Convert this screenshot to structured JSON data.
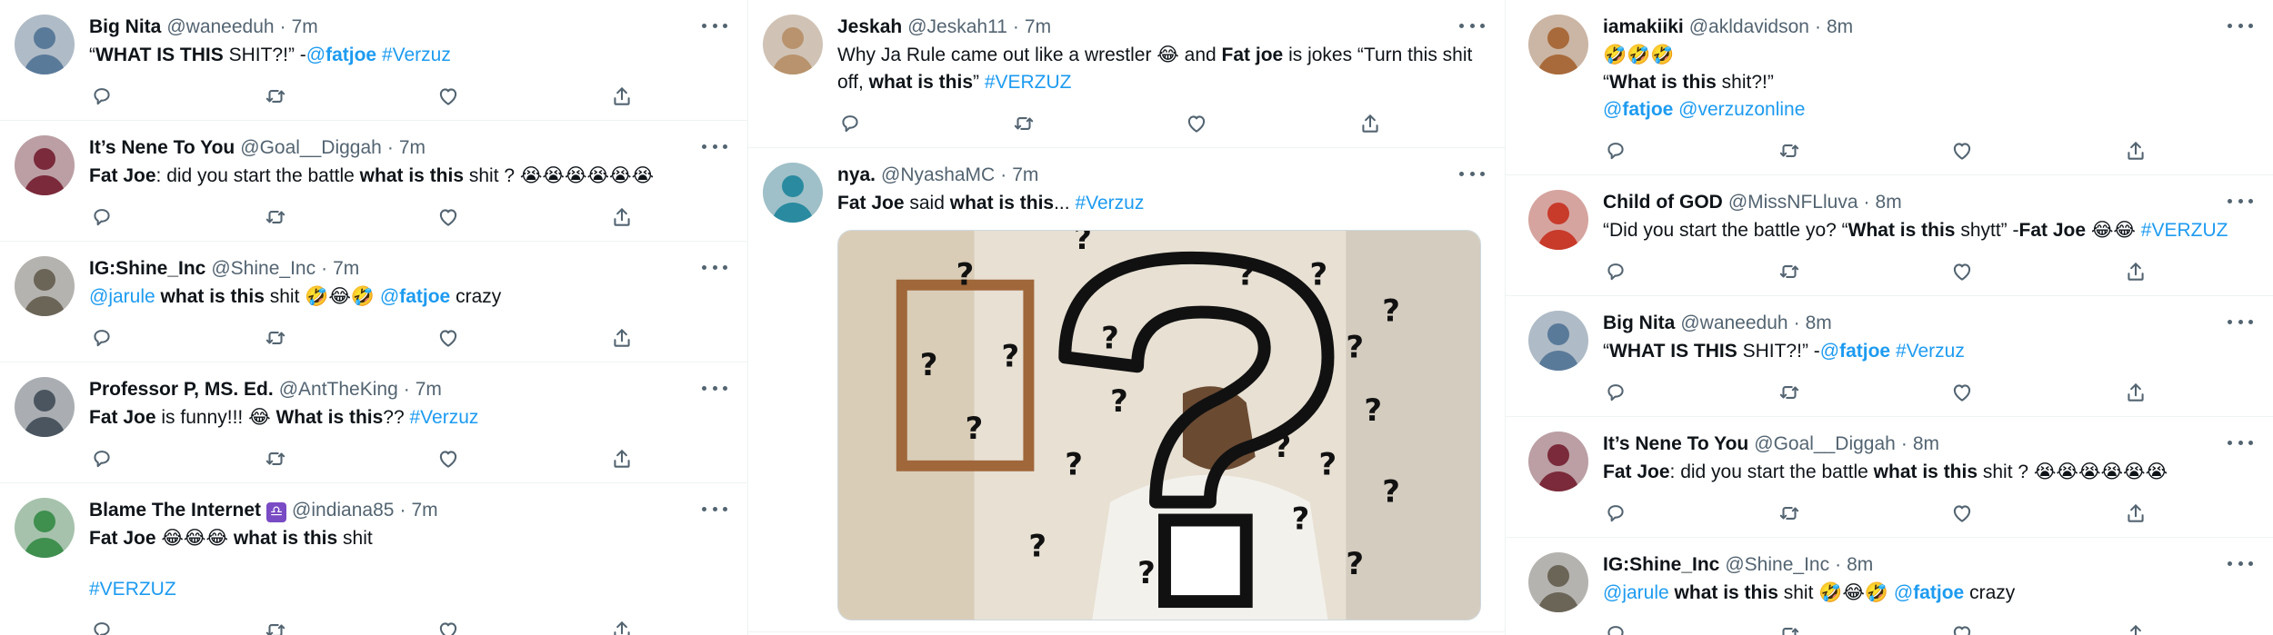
{
  "columns": [
    {
      "tweets": [
        {
          "name": "Big Nita",
          "handle": "@waneeduh",
          "time": "7m",
          "avatar_color": "#5a7a9a",
          "segments": [
            {
              "t": "“",
              "s": "n"
            },
            {
              "t": "WHAT IS THIS",
              "s": "b"
            },
            {
              "t": " SHIT?!” -",
              "s": "n"
            },
            {
              "t": "@",
              "s": "l"
            },
            {
              "t": "fatjoe",
              "s": "lb"
            },
            {
              "t": " #Verzuz",
              "s": "l"
            }
          ]
        },
        {
          "name": "It’s Nene To You",
          "handle": "@Goal__Diggah",
          "time": "7m",
          "avatar_color": "#7a2a3a",
          "segments": [
            {
              "t": "Fat Joe",
              "s": "b"
            },
            {
              "t": ": did you start the battle ",
              "s": "n"
            },
            {
              "t": "what is this",
              "s": "b"
            },
            {
              "t": " shit ? 😭😭😭😭😭😭",
              "s": "n"
            }
          ]
        },
        {
          "name": "IG:Shine_Inc",
          "handle": "@Shine_Inc",
          "time": "7m",
          "avatar_color": "#6b6558",
          "segments": [
            {
              "t": "@jarule",
              "s": "l"
            },
            {
              "t": " ",
              "s": "n"
            },
            {
              "t": "what is this",
              "s": "b"
            },
            {
              "t": " shit 🤣😂🤣 ",
              "s": "n"
            },
            {
              "t": "@",
              "s": "l"
            },
            {
              "t": "fatjoe",
              "s": "lb"
            },
            {
              "t": " crazy",
              "s": "n"
            }
          ]
        },
        {
          "name": "Professor P, MS. Ed.",
          "handle": "@AntTheKing",
          "time": "7m",
          "avatar_color": "#4a5560",
          "segments": [
            {
              "t": "Fat Joe",
              "s": "b"
            },
            {
              "t": " is funny!!! 😂 ",
              "s": "n"
            },
            {
              "t": "What is this",
              "s": "b"
            },
            {
              "t": "?? ",
              "s": "n"
            },
            {
              "t": "#Verzuz",
              "s": "l"
            }
          ]
        },
        {
          "name": "Blame The Internet",
          "badge": "♎",
          "handle": "@indiana85",
          "time": "7m",
          "avatar_color": "#3f8f4f",
          "segments": [
            {
              "t": "Fat Joe",
              "s": "b"
            },
            {
              "t": " 😂😂😂 ",
              "s": "n"
            },
            {
              "t": "what is this",
              "s": "b"
            },
            {
              "t": " shit",
              "s": "n"
            },
            {
              "t": "",
              "s": "br"
            },
            {
              "t": "#VERZUZ",
              "s": "l"
            }
          ]
        }
      ]
    },
    {
      "tweets": [
        {
          "name": "Jeskah",
          "handle": "@Jeskah11",
          "time": "7m",
          "avatar_color": "#b8936d",
          "segments": [
            {
              "t": "Why Ja Rule came out like a wrestler 😂 and ",
              "s": "n"
            },
            {
              "t": "Fat joe",
              "s": "b"
            },
            {
              "t": " is jokes “Turn this shit off, ",
              "s": "n"
            },
            {
              "t": "what is this",
              "s": "b"
            },
            {
              "t": "” ",
              "s": "n"
            },
            {
              "t": "#VERZUZ",
              "s": "l"
            }
          ]
        },
        {
          "name": "nya.",
          "handle": "@NyashaMC",
          "time": "7m",
          "avatar_color": "#2a8aa0",
          "segments": [
            {
              "t": "Fat Joe",
              "s": "b"
            },
            {
              "t": " said ",
              "s": "n"
            },
            {
              "t": "what is this",
              "s": "b"
            },
            {
              "t": "... ",
              "s": "n"
            },
            {
              "t": "#Verzuz",
              "s": "l"
            }
          ],
          "media": "question-mark-meme"
        }
      ]
    },
    {
      "tweets": [
        {
          "name": "iamakiiki",
          "handle": "@akldavidson",
          "time": "8m",
          "avatar_color": "#a86a3a",
          "segments": [
            {
              "t": "🤣🤣🤣",
              "s": "n"
            },
            {
              "t": "",
              "s": "br0"
            },
            {
              "t": "“",
              "s": "n"
            },
            {
              "t": "What is this",
              "s": "b"
            },
            {
              "t": " shit?!”",
              "s": "n"
            },
            {
              "t": "",
              "s": "br0"
            },
            {
              "t": "@",
              "s": "l"
            },
            {
              "t": "fatjoe",
              "s": "lb"
            },
            {
              "t": " @verzuzonline",
              "s": "l"
            }
          ]
        },
        {
          "name": "Child of GOD",
          "handle": "@MissNFLluva",
          "time": "8m",
          "avatar_color": "#c83a2a",
          "segments": [
            {
              "t": "“Did you start the battle yo? “",
              "s": "n"
            },
            {
              "t": "What is this",
              "s": "b"
            },
            {
              "t": " shytt” -",
              "s": "n"
            },
            {
              "t": "Fat Joe",
              "s": "b"
            },
            {
              "t": " 😂😂 ",
              "s": "n"
            },
            {
              "t": "#VERZUZ",
              "s": "l"
            }
          ]
        },
        {
          "name": "Big Nita",
          "handle": "@waneeduh",
          "time": "8m",
          "avatar_color": "#5a7a9a",
          "segments": [
            {
              "t": "“",
              "s": "n"
            },
            {
              "t": "WHAT IS THIS",
              "s": "b"
            },
            {
              "t": " SHIT?!” -",
              "s": "n"
            },
            {
              "t": "@",
              "s": "l"
            },
            {
              "t": "fatjoe",
              "s": "lb"
            },
            {
              "t": " #Verzuz",
              "s": "l"
            }
          ]
        },
        {
          "name": "It’s Nene To You",
          "handle": "@Goal__Diggah",
          "time": "8m",
          "avatar_color": "#7a2a3a",
          "segments": [
            {
              "t": "Fat Joe",
              "s": "b"
            },
            {
              "t": ": did you start the battle ",
              "s": "n"
            },
            {
              "t": "what is this",
              "s": "b"
            },
            {
              "t": " shit ? 😭😭😭😭😭😭",
              "s": "n"
            }
          ]
        },
        {
          "name": "IG:Shine_Inc",
          "handle": "@Shine_Inc",
          "time": "8m",
          "avatar_color": "#6b6558",
          "segments": [
            {
              "t": "@jarule",
              "s": "l"
            },
            {
              "t": " ",
              "s": "n"
            },
            {
              "t": "what is this",
              "s": "b"
            },
            {
              "t": " shit 🤣😂🤣 ",
              "s": "n"
            },
            {
              "t": "@",
              "s": "l"
            },
            {
              "t": "fatjoe",
              "s": "lb"
            },
            {
              "t": " crazy",
              "s": "n"
            }
          ]
        }
      ]
    }
  ],
  "icons": [
    "reply-icon",
    "retweet-icon",
    "like-icon",
    "share-icon",
    "more-icon"
  ],
  "colors": {
    "link": "#1d9bf0",
    "muted": "#536471",
    "text": "#0f1419",
    "border": "#eff3f4"
  }
}
